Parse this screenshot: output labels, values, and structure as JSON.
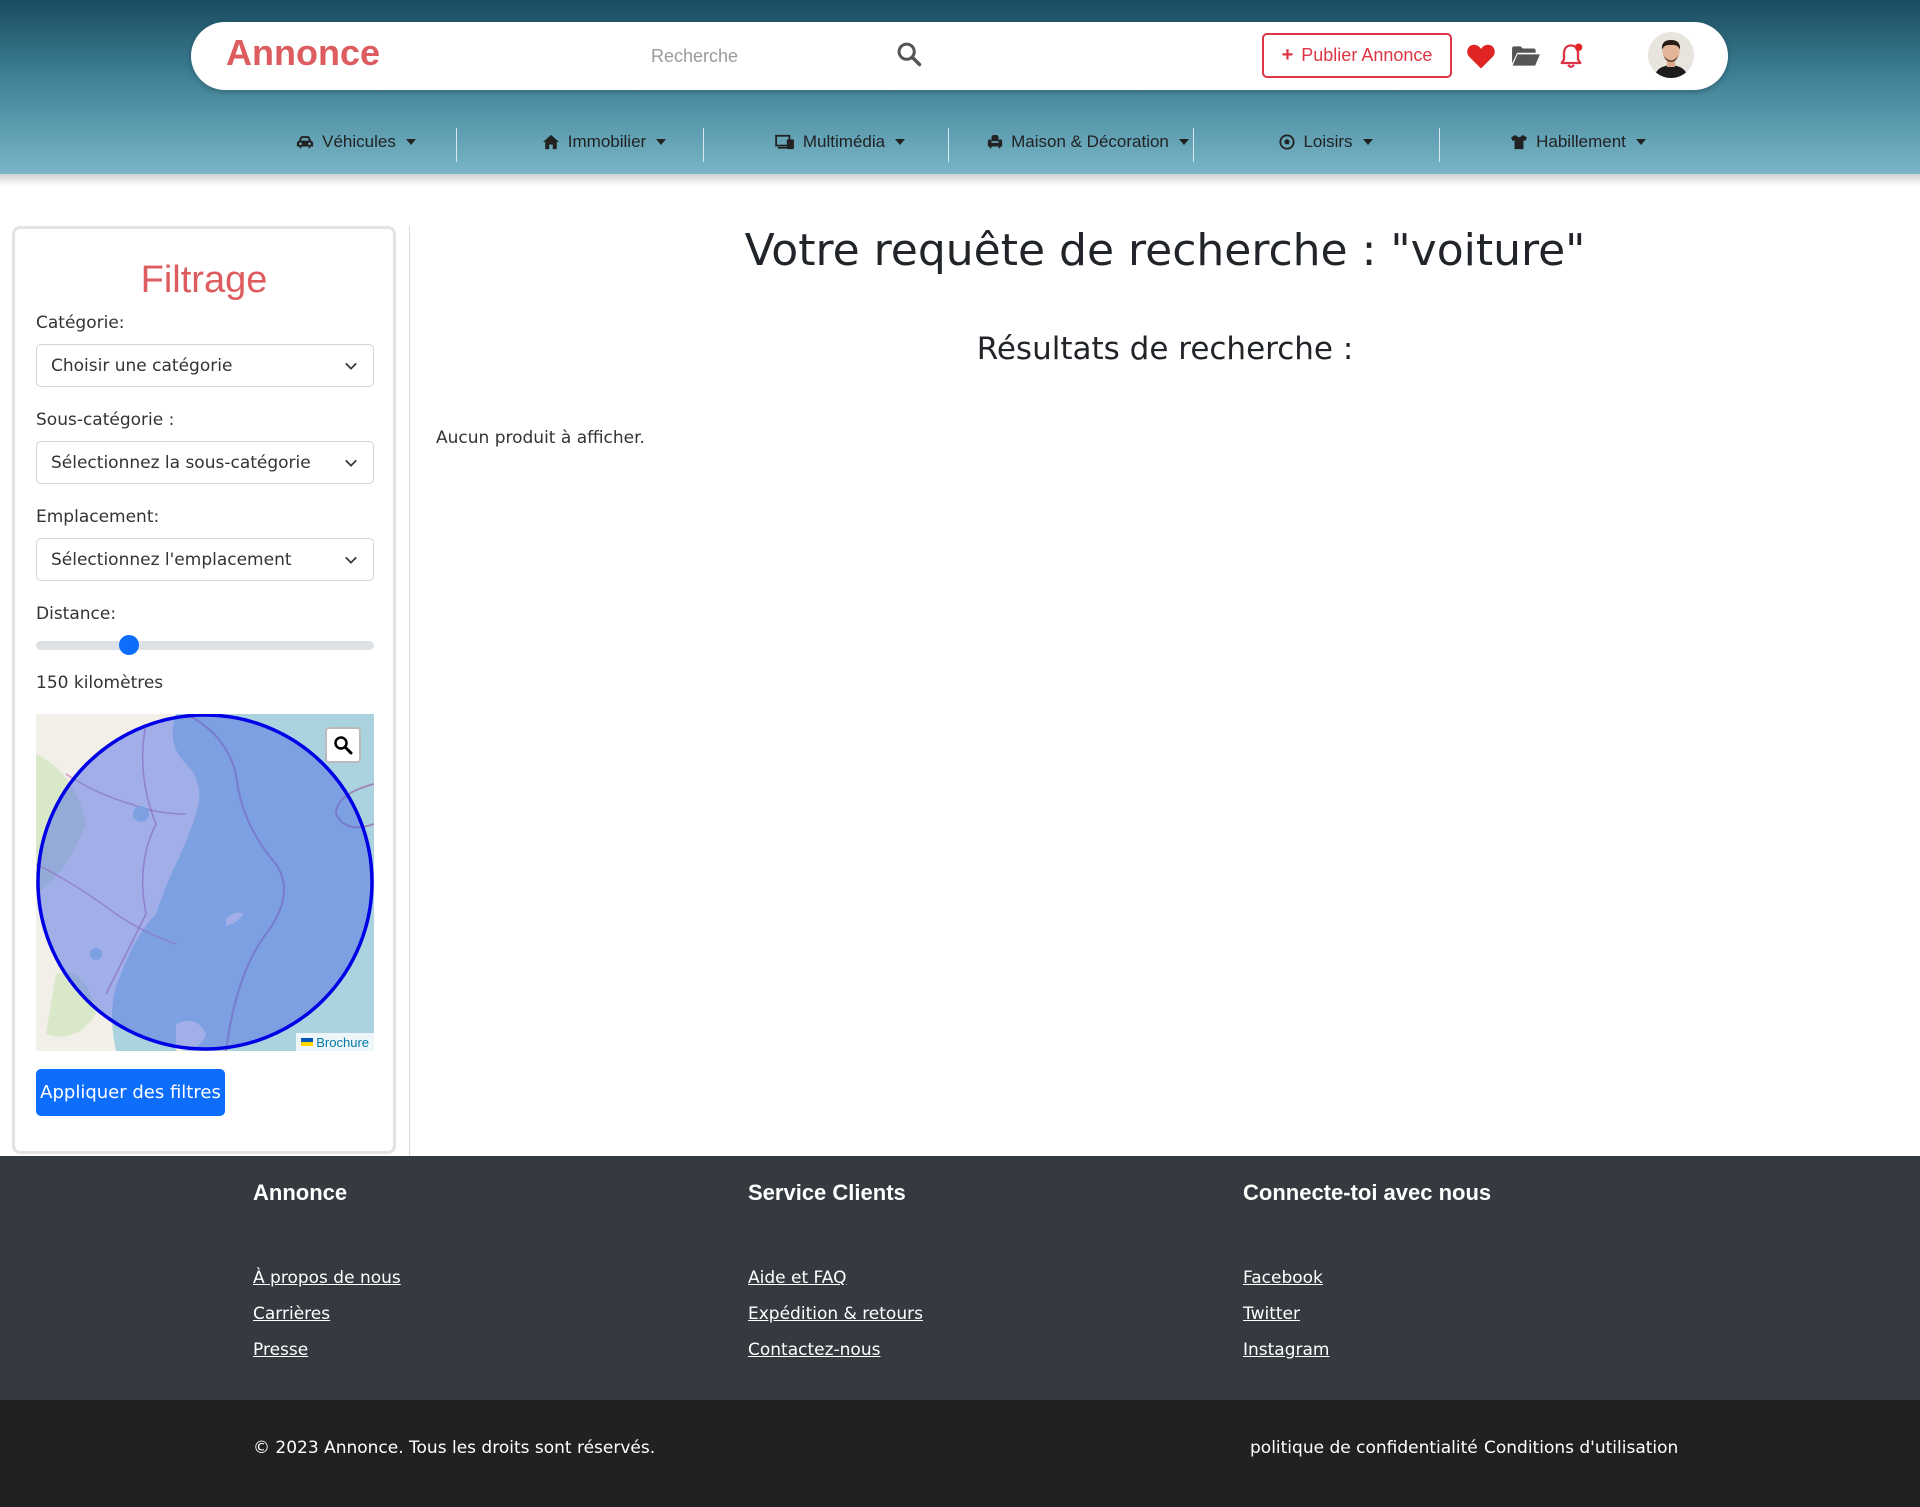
{
  "header": {
    "brand": "Annonce",
    "search_placeholder": "Recherche",
    "publish_label": "Publier Annonce",
    "colors": {
      "brand": "#dc5c60",
      "publish": "#dc3545",
      "heart": "#e02424"
    }
  },
  "categories": [
    {
      "label": "Véhicules",
      "icon": "car-icon"
    },
    {
      "label": "Immobilier",
      "icon": "home-icon"
    },
    {
      "label": "Multimédia",
      "icon": "devices-icon"
    },
    {
      "label": "Maison & Décoration",
      "icon": "couch-icon"
    },
    {
      "label": "Loisirs",
      "icon": "soccer-ball-icon"
    },
    {
      "label": "Habillement",
      "icon": "shirt-icon"
    }
  ],
  "sidebar": {
    "title": "Filtrage",
    "category_label": "Catégorie:",
    "category_value": "Choisir une catégorie",
    "subcategory_label": "Sous-catégorie :",
    "subcategory_value": "Sélectionnez la sous-catégorie",
    "location_label": "Emplacement:",
    "location_value": "Sélectionnez l'emplacement",
    "distance_label": "Distance:",
    "distance_fraction": 0.26,
    "distance_value": "150 kilomètres",
    "map_attribution": "Brochure",
    "apply_label": "Appliquer des filtres"
  },
  "main": {
    "query_title": "Votre requête de recherche : \"voiture\"",
    "results_title": "Résultats de recherche :",
    "empty_message": "Aucun produit à afficher."
  },
  "footer": {
    "columns": [
      {
        "title": "Annonce",
        "links": [
          "À propos de nous",
          "Carrières",
          "Presse"
        ]
      },
      {
        "title": "Service Clients",
        "links": [
          "Aide et FAQ",
          "Expédition & retours",
          "Contactez-nous"
        ]
      },
      {
        "title": "Connecte-toi avec nous",
        "links": [
          "Facebook",
          "Twitter",
          "Instagram"
        ]
      }
    ],
    "copyright": "© 2023 Annonce. Tous les droits sont réservés.",
    "privacy": "politique de confidentialité",
    "terms": "Conditions d'utilisation"
  }
}
